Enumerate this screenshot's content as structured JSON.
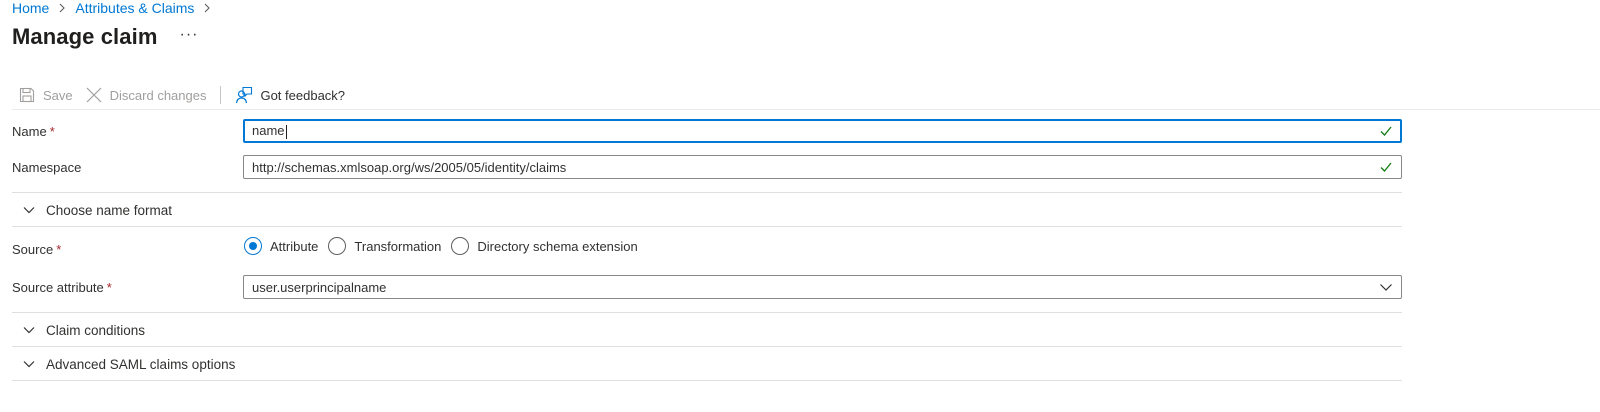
{
  "breadcrumb": {
    "home": "Home",
    "attributes": "Attributes & Claims"
  },
  "page": {
    "title": "Manage claim",
    "more": "···"
  },
  "toolbar": {
    "save": "Save",
    "discard": "Discard changes",
    "feedback": "Got feedback?"
  },
  "form": {
    "name": {
      "label": "Name",
      "required": "*",
      "value": "name"
    },
    "namespace": {
      "label": "Namespace",
      "value": "http://schemas.xmlsoap.org/ws/2005/05/identity/claims"
    },
    "name_format_section": "Choose name format",
    "source": {
      "label": "Source",
      "required": "*",
      "options": [
        "Attribute",
        "Transformation",
        "Directory schema extension"
      ],
      "selected": "Attribute"
    },
    "source_attribute": {
      "label": "Source attribute",
      "required": "*",
      "value": "user.userprincipalname"
    },
    "claim_conditions_section": "Claim conditions",
    "advanced_section": "Advanced SAML claims options"
  },
  "colors": {
    "accent": "#0078d4",
    "valid": "#107c10",
    "required": "#a4262c"
  }
}
